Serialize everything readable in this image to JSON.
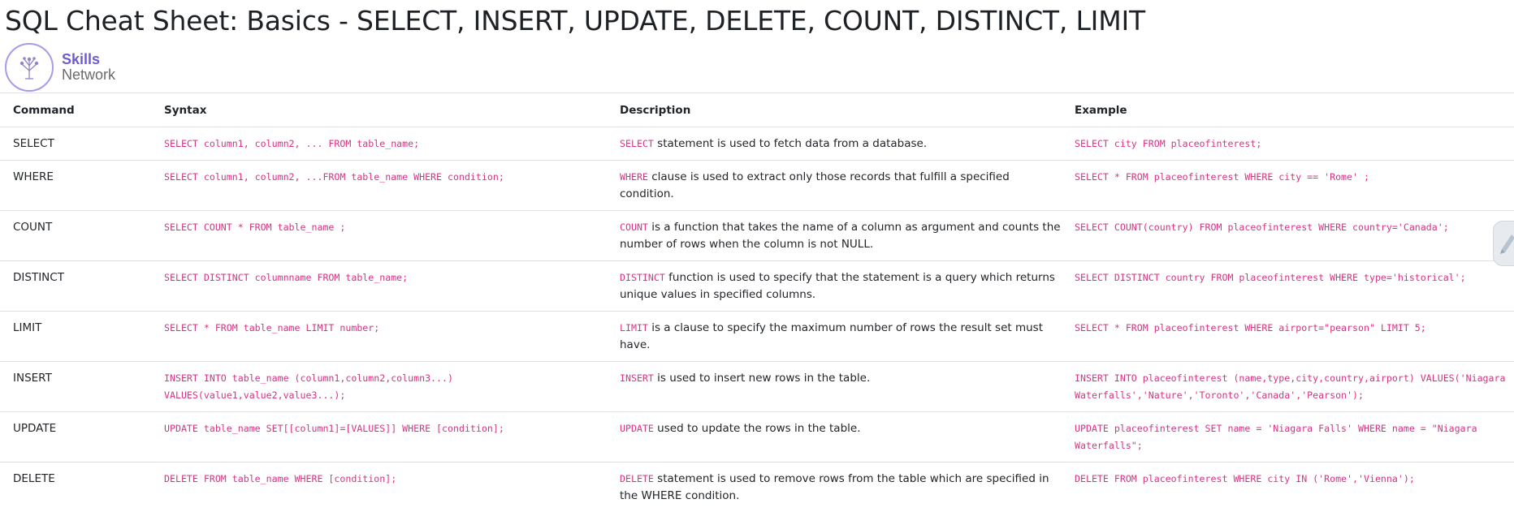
{
  "page": {
    "title": "SQL Cheat Sheet: Basics - SELECT, INSERT, UPDATE, DELETE, COUNT, DISTINCT, LIMIT"
  },
  "logo": {
    "line1": "Skills",
    "line2": "Network"
  },
  "table": {
    "headers": [
      "Command",
      "Syntax",
      "Description",
      "Example"
    ],
    "rows": [
      {
        "command": "SELECT",
        "syntax": "SELECT column1, column2, ... FROM table_name;",
        "desc_code": "SELECT",
        "desc_text": " statement is used to fetch data from a database.",
        "example": "SELECT city FROM placeofinterest;"
      },
      {
        "command": "WHERE",
        "syntax": "SELECT column1, column2, ...FROM table_name WHERE condition;",
        "desc_code": "WHERE",
        "desc_text": " clause is used to extract only those records that fulfill a specified condition.",
        "example": "SELECT * FROM placeofinterest WHERE city == 'Rome' ;"
      },
      {
        "command": "COUNT",
        "syntax": "SELECT COUNT * FROM table_name ;",
        "desc_code": "COUNT",
        "desc_text": " is a function that takes the name of a column as argument and counts the number of rows when the column is not NULL.",
        "example": "SELECT COUNT(country) FROM placeofinterest WHERE country='Canada';"
      },
      {
        "command": "DISTINCT",
        "syntax": "SELECT DISTINCT columnname FROM table_name;",
        "desc_code": "DISTINCT",
        "desc_text": " function is used to specify that the statement is a query which returns unique values in specified columns.",
        "example": "SELECT DISTINCT country FROM placeofinterest WHERE type='historical';"
      },
      {
        "command": "LIMIT",
        "syntax": "SELECT * FROM table_name LIMIT number;",
        "desc_code": "LIMIT",
        "desc_text": " is a clause to specify the maximum number of rows the result set must have.",
        "example": "SELECT * FROM placeofinterest WHERE airport=\"pearson\" LIMIT 5;"
      },
      {
        "command": "INSERT",
        "syntax": "INSERT INTO table_name (column1,column2,column3...) VALUES(value1,value2,value3...);",
        "desc_code": "INSERT",
        "desc_text": " is used to insert new rows in the table.",
        "example": "INSERT INTO placeofinterest (name,type,city,country,airport) VALUES('Niagara Waterfalls','Nature','Toronto','Canada','Pearson');"
      },
      {
        "command": "UPDATE",
        "syntax": "UPDATE table_name SET[[column1]=[VALUES]] WHERE [condition];",
        "desc_code": "UPDATE",
        "desc_text": " used to update the rows in the table.",
        "example": "UPDATE placeofinterest SET name = 'Niagara Falls' WHERE name = \"Niagara Waterfalls\";"
      },
      {
        "command": "DELETE",
        "syntax": "DELETE FROM table_name WHERE [condition];",
        "desc_code": "DELETE",
        "desc_text": " statement is used to remove rows from the table which are specified in the WHERE condition.",
        "example": "DELETE FROM placeofinterest WHERE city IN ('Rome','Vienna');"
      }
    ]
  },
  "colors": {
    "code": "#d63384",
    "text": "#212529",
    "border": "#dee2e6",
    "brand": "#6f5ad3"
  },
  "icons": {
    "logo": "skills-network-tree-icon",
    "side_widget": "feedback-icon"
  }
}
